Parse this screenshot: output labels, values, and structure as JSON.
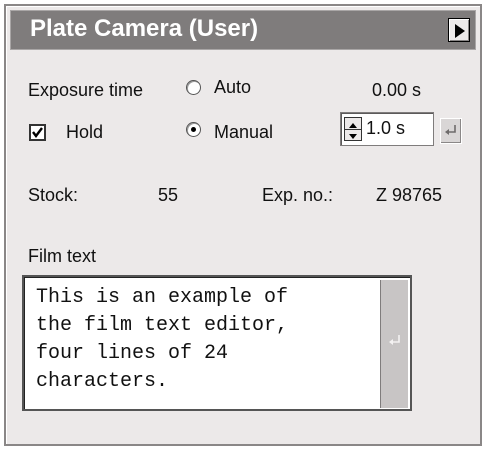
{
  "window": {
    "title": "Plate Camera (User)",
    "menu_icon": "triangle-right-icon"
  },
  "exposure": {
    "label": "Exposure time",
    "auto_label": "Auto",
    "manual_label": "Manual",
    "selected_mode": "Manual",
    "auto_time": "0.00 s",
    "manual_time": "1.0 s"
  },
  "hold": {
    "label": "Hold",
    "checked": true
  },
  "info": {
    "stock_label": "Stock:",
    "stock_value": "55",
    "exp_label": "Exp. no.:",
    "exp_value": "Z 98765"
  },
  "film_text": {
    "label": "Film text",
    "lines": [
      "This is an example of",
      "the film text editor,",
      "four lines of 24",
      "characters."
    ]
  },
  "icons": {
    "enter": "enter-arrow-icon",
    "spin": "spin-arrows-icon",
    "check": "checkmark-icon"
  }
}
